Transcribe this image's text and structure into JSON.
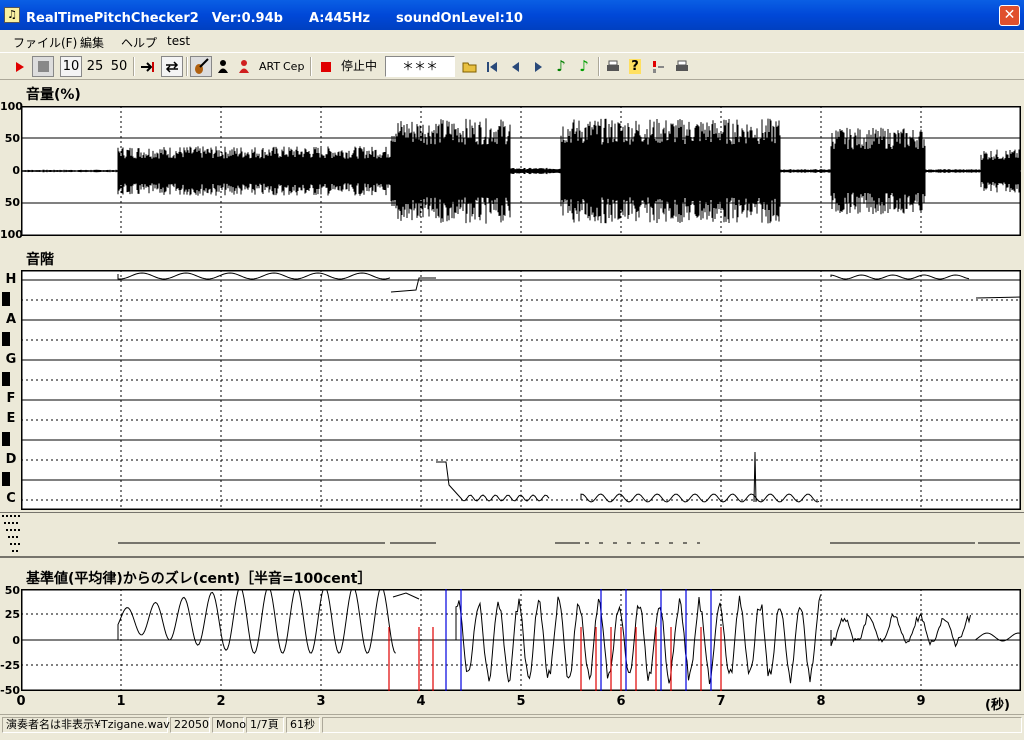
{
  "window": {
    "title": "RealTimePitchChecker2　Ver:0.94b　　A:445Hz　　soundOnLevel:10",
    "close_glyph": "✕",
    "app_icon_glyph": "♫"
  },
  "menu": [
    "ファイル(F)",
    "編集",
    "ヘルプ",
    "test"
  ],
  "toolbar": {
    "speed_10": "10",
    "speed_25": "25",
    "speed_50": "50",
    "art_label": "ART",
    "cep_label": "Cep",
    "stop_state": "停止中",
    "note_display": "＊＊＊"
  },
  "volume_panel": {
    "label": "音量(%)",
    "y_ticks": [
      "100",
      "50",
      "0",
      "50",
      "100"
    ]
  },
  "scale_panel": {
    "label": "音階",
    "notes": [
      "H",
      "A",
      "G",
      "F",
      "E",
      "D",
      "C"
    ]
  },
  "cent_panel": {
    "label": "基準値(平均律)からのズレ(cent)［半音=100cent］",
    "y_ticks": [
      "50",
      "25",
      "0",
      "-25",
      "-50"
    ]
  },
  "time_axis": {
    "ticks": [
      "0",
      "1",
      "2",
      "3",
      "4",
      "5",
      "6",
      "7",
      "8",
      "9"
    ],
    "unit_label": "(秒)"
  },
  "statusbar": {
    "file": "演奏者名は非表示¥Tzigane.wav",
    "sample_rate": "22050",
    "channels": "Mono",
    "page": "1/7頁",
    "duration": "61秒"
  },
  "colors": {
    "titlebar": "#0a5fe4",
    "waveform": "#000000",
    "cent_red": "#e00000",
    "cent_blue": "#0000e0"
  }
}
